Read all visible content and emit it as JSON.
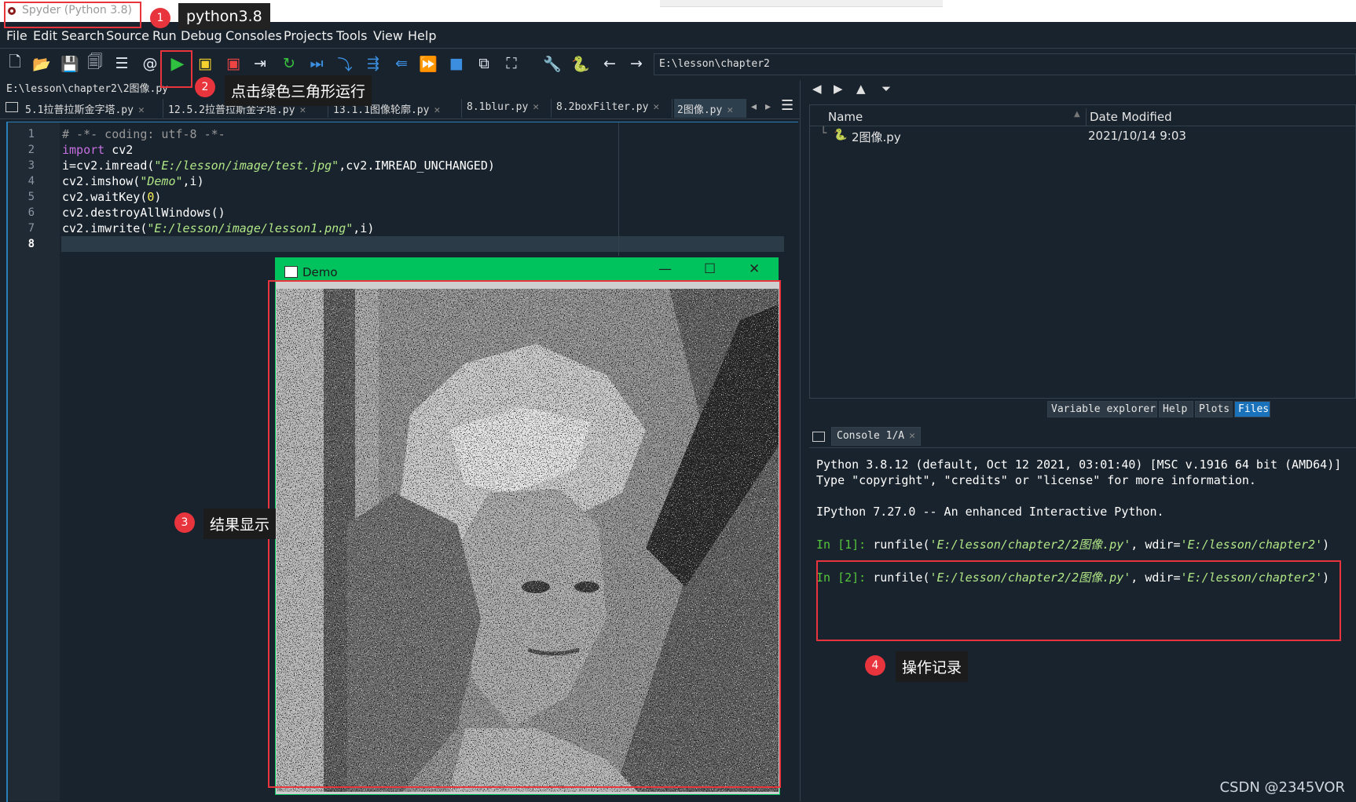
{
  "window": {
    "title": "Spyder (Python 3.8)"
  },
  "menu": [
    "File",
    "Edit",
    "Search",
    "Source",
    "Run",
    "Debug",
    "Consoles",
    "Projects",
    "Tools",
    "View",
    "Help"
  ],
  "toolbar": {
    "path": "E:\\lesson\\chapter2"
  },
  "editor": {
    "path": "E:\\lesson\\chapter2\\2图像.py",
    "tabs": [
      {
        "label": "5.1拉普拉斯金字塔.py"
      },
      {
        "label": "12.5.2拉普拉斯金字塔.py"
      },
      {
        "label": "13.1.1图像轮廓.py"
      },
      {
        "label": "8.1blur.py"
      },
      {
        "label": "8.2boxFilter.py"
      },
      {
        "label": "2图像.py"
      }
    ],
    "line_numbers": [
      "1",
      "2",
      "3",
      "4",
      "5",
      "6",
      "7",
      "8"
    ],
    "code": {
      "l1": "# -*- coding: utf-8 -*-",
      "l2_kw": "import",
      "l2_rest": " cv2",
      "l3_a": "i=cv2.imread(",
      "l3_s": "\"E:/lesson/image/test.jpg\"",
      "l3_b": ",cv2.IMREAD_UNCHANGED)",
      "l4_a": "cv2.imshow(",
      "l4_s": "\"Demo\"",
      "l4_b": ",i)",
      "l5_a": "cv2.waitKey(",
      "l5_n": "0",
      "l5_b": ")",
      "l6": "cv2.destroyAllWindows()",
      "l7_a": "cv2.imwrite(",
      "l7_s": "\"E:/lesson/image/lesson1.png\"",
      "l7_b": ",i)"
    }
  },
  "demo_window": {
    "title": "Demo",
    "minimize": "—",
    "maximize": "☐",
    "close": "✕"
  },
  "files": {
    "columns": [
      "Name",
      "Date Modified"
    ],
    "rows": [
      {
        "name": "2图像.py",
        "date": "2021/10/14 9:03"
      }
    ]
  },
  "pane_tabs": [
    "Variable explorer",
    "Help",
    "Plots",
    "Files"
  ],
  "console": {
    "tab": "Console 1/A",
    "banner1": "Python 3.8.12 (default, Oct 12 2021, 03:01:40) [MSC v.1916 64 bit (AMD64)]",
    "banner2": "Type \"copyright\", \"credits\" or \"license\" for more information.",
    "banner3": "IPython 7.27.0 -- An enhanced Interactive Python.",
    "in1_prompt": "In [1]:",
    "in2_prompt": "In [2]:",
    "run_a": " runfile(",
    "run_file": "'E:/lesson/chapter2/2图像.py'",
    "run_b": ", wdir=",
    "run_dir": "'E:/lesson/chapter2'",
    "run_c": ")"
  },
  "annotations": {
    "n1": "1",
    "c1": "python3.8",
    "n2": "2",
    "c2": "点击绿色三角形运行",
    "n3": "3",
    "c3": "结果显示",
    "n4": "4",
    "c4": "操作记录"
  },
  "watermark": "CSDN @2345VOR",
  "colors": {
    "accent": "#e8343c",
    "demo_bar": "#00c35e",
    "background": "#19232d"
  }
}
